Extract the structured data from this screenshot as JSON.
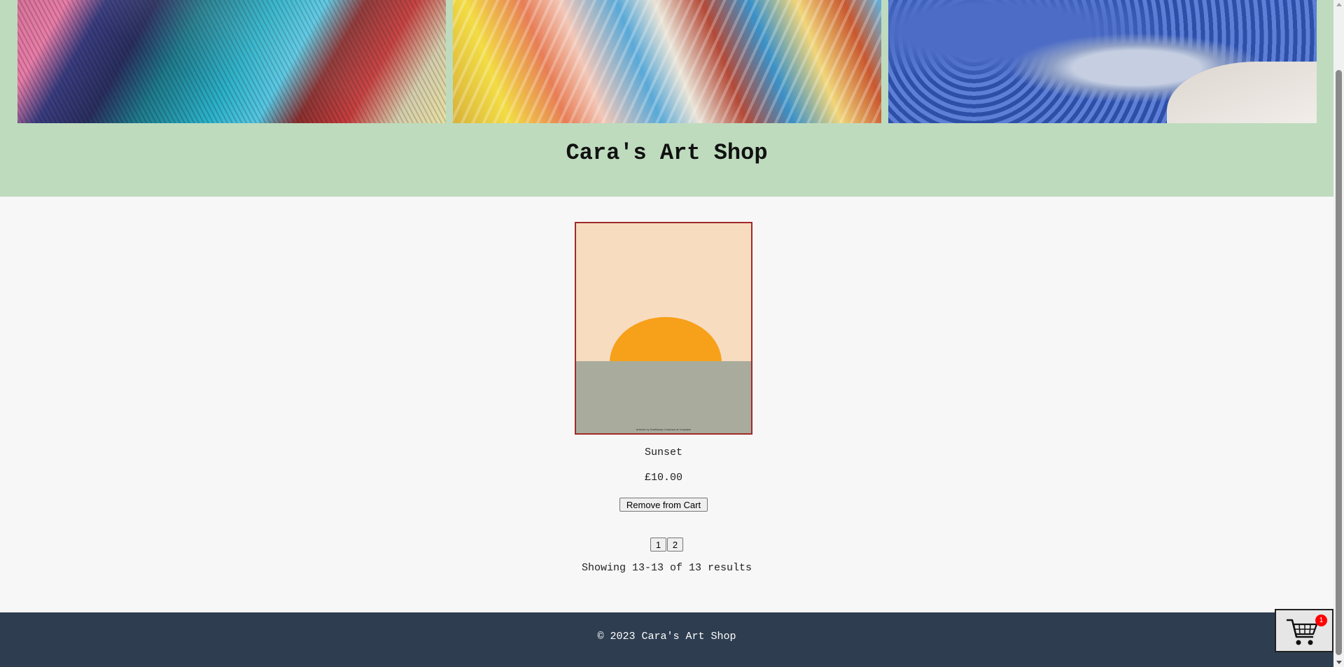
{
  "header": {
    "title": "Cara's Art Shop",
    "banner_images": [
      "paint-brushes-image",
      "abstract-painting-image",
      "pottery-image"
    ]
  },
  "product": {
    "name": "Sunset",
    "price": "£10.00",
    "remove_label": "Remove from Cart",
    "image_caption": "Artwork by Karthikeya Chauhan at Unsplash",
    "border_color": "#a02a2a"
  },
  "pagination": {
    "pages": [
      "1",
      "2"
    ],
    "results_text": "Showing 13-13 of 13 results"
  },
  "footer": {
    "text": "© 2023 Cara's Art Shop"
  },
  "cart": {
    "icon": "shopping-cart-icon",
    "count": "1",
    "badge_color": "#ff0000"
  },
  "colors": {
    "header_bg": "#bedbbe",
    "body_bg": "#f7f7f7",
    "footer_bg": "#2e3e50"
  }
}
